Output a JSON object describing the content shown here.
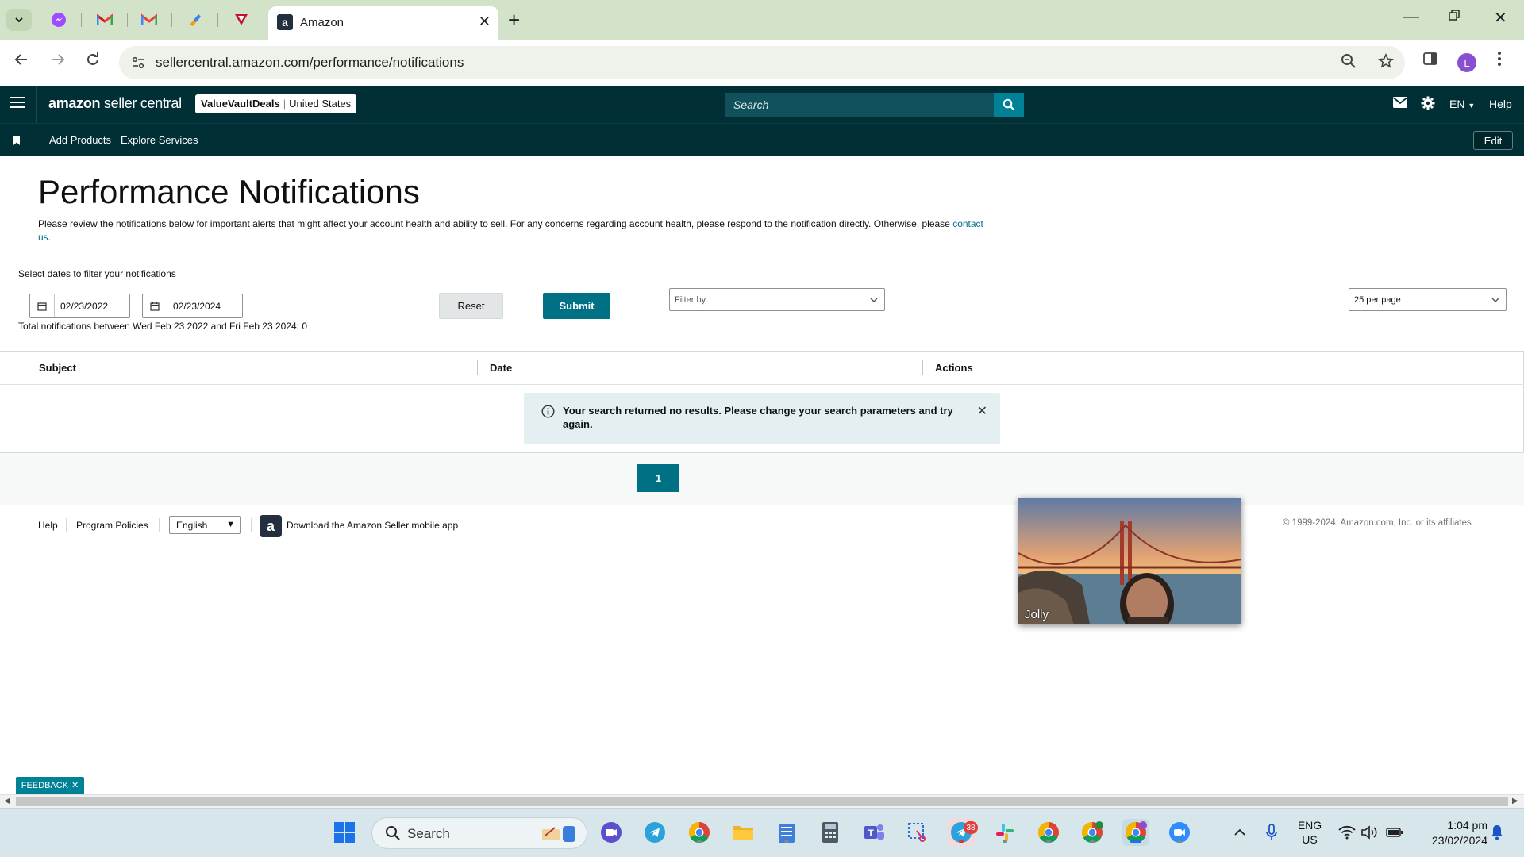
{
  "browser": {
    "active_tab_title": "Amazon",
    "url": "sellercentral.amazon.com/performance/notifications",
    "profile_initial": "L",
    "pinned_tabs": [
      "messenger-icon",
      "gmail-icon",
      "gmail-icon",
      "todoist-icon",
      "tradingview-icon"
    ]
  },
  "header": {
    "logo_main": "amazon",
    "logo_sub": "seller central",
    "store_name": "ValueVaultDeals",
    "marketplace": "United States",
    "search_placeholder": "Search",
    "language": "EN",
    "help": "Help"
  },
  "subnav": {
    "links": [
      "Add Products",
      "Explore Services"
    ],
    "edit": "Edit"
  },
  "page": {
    "title": "Performance Notifications",
    "description": "Please review the notifications below for important alerts that might affect your account health and ability to sell. For any concerns regarding account health, please respond to the notification directly. Otherwise, please",
    "contact_link": "contact us",
    "filter_label": "Select dates to filter your notifications",
    "start_date": "02/23/2022",
    "end_date": "02/23/2024",
    "reset_label": "Reset",
    "submit_label": "Submit",
    "filter_by": "Filter by",
    "per_page": "25 per page",
    "total_text": "Total notifications between Wed Feb 23 2022 and Fri Feb 23 2024: 0"
  },
  "table": {
    "columns": [
      "Subject",
      "Date",
      "Actions"
    ],
    "empty_message": "Your search returned no results. Please change your search parameters and try again.",
    "current_page": "1"
  },
  "footer": {
    "help": "Help",
    "program_policies": "Program Policies",
    "language": "English",
    "download_app": "Download the Amazon Seller mobile app",
    "copyright": "© 1999-2024, Amazon.com, Inc. or its affiliates"
  },
  "video": {
    "participant_name": "Jolly"
  },
  "feedback": "FEEDBACK",
  "taskbar": {
    "search_placeholder": "Search",
    "telegram_badge": "38",
    "lang_line1": "ENG",
    "lang_line2": "US",
    "time": "1:04 pm",
    "date": "23/02/2024"
  },
  "colors": {
    "header_bg": "#002f36",
    "accent_teal": "#007185",
    "search_button": "#008296",
    "alert_bg": "#e3eff1"
  }
}
